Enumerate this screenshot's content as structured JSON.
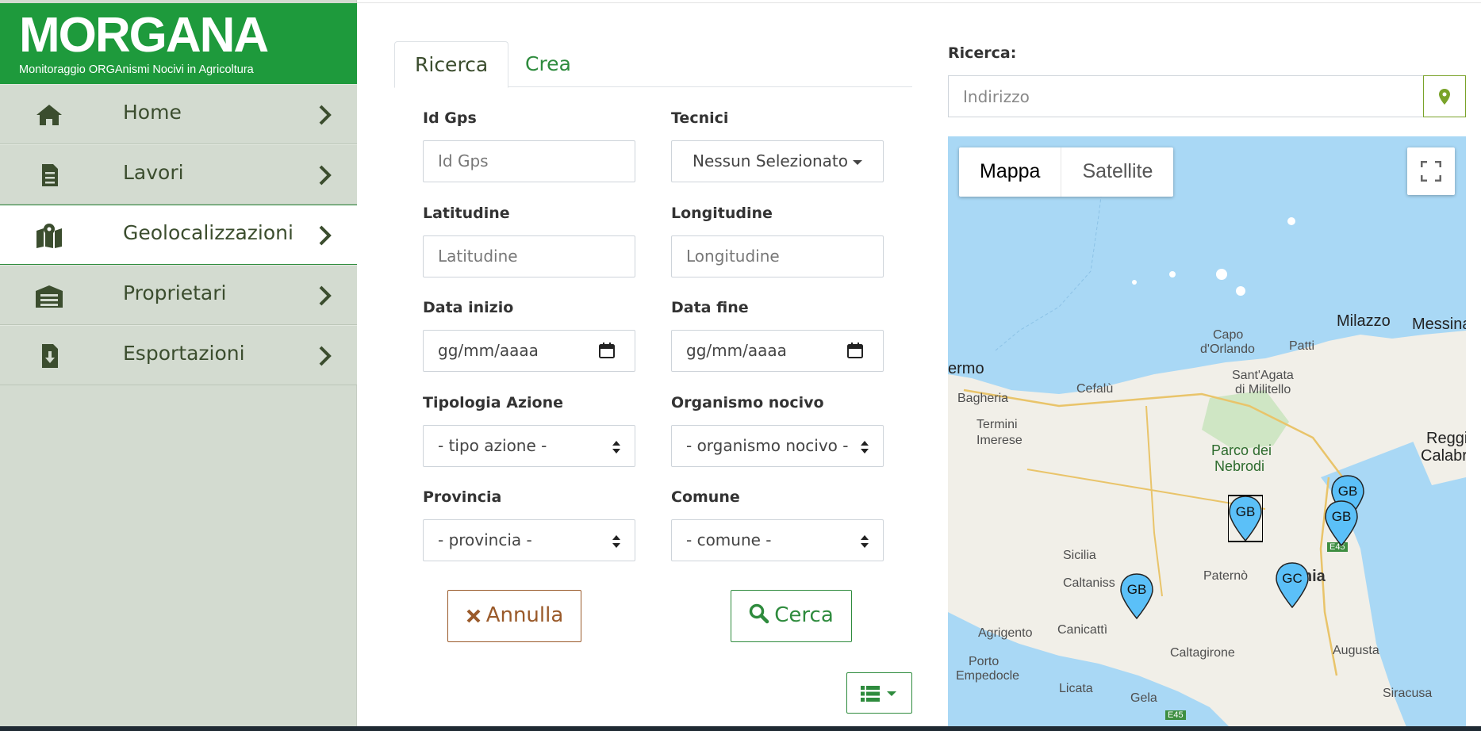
{
  "brand": {
    "title": "MORGANA",
    "subtitle": "Monitoraggio ORGAnismi Nocivi in Agricoltura",
    "color": "#1e9a3c"
  },
  "sidebar": {
    "items": [
      {
        "label": "Home",
        "icon": "home-icon",
        "active": false
      },
      {
        "label": "Lavori",
        "icon": "document-icon",
        "active": false
      },
      {
        "label": "Geolocalizzazioni",
        "icon": "map-marker-icon",
        "active": true
      },
      {
        "label": "Proprietari",
        "icon": "warehouse-icon",
        "active": false
      },
      {
        "label": "Esportazioni",
        "icon": "file-download-icon",
        "active": false
      }
    ]
  },
  "tabs": [
    {
      "label": "Ricerca",
      "active": true
    },
    {
      "label": "Crea",
      "active": false
    }
  ],
  "form": {
    "id_gps": {
      "label": "Id Gps",
      "placeholder": "Id Gps"
    },
    "tecnici": {
      "label": "Tecnici",
      "value": "Nessun Selezionato"
    },
    "latitudine": {
      "label": "Latitudine",
      "placeholder": "Latitudine"
    },
    "longitudine": {
      "label": "Longitudine",
      "placeholder": "Longitudine"
    },
    "data_inizio": {
      "label": "Data inizio",
      "placeholder": "gg/mm/aaaa"
    },
    "data_fine": {
      "label": "Data fine",
      "placeholder": "gg/mm/aaaa"
    },
    "tipologia_azione": {
      "label": "Tipologia Azione",
      "value": "- tipo azione -"
    },
    "organismo_nocivo": {
      "label": "Organismo nocivo",
      "value": "- organismo nocivo -"
    },
    "provincia": {
      "label": "Provincia",
      "value": "- provincia -"
    },
    "comune": {
      "label": "Comune",
      "value": "- comune -"
    },
    "annulla_label": "Annulla",
    "cerca_label": "Cerca"
  },
  "search": {
    "label": "Ricerca:",
    "placeholder": "Indirizzo"
  },
  "map": {
    "type_map": "Mappa",
    "type_satellite": "Satellite",
    "places": {
      "ermo": "ermo",
      "bagheria": "Bagheria",
      "termini": "Termini",
      "imerese": "Imerese",
      "cefalu": "Cefalù",
      "capo": "Capo",
      "dorlando": "d'Orlando",
      "patti": "Patti",
      "milazzo": "Milazzo",
      "messina": "Messina",
      "santagata": "Sant'Agata",
      "dimilitello": "di Militello",
      "parco": "Parco dei",
      "nebrodi": "Nebrodi",
      "reggi": "Reggi",
      "calabr": "Calabr",
      "sicilia": "Sicilia",
      "caltaniss": "Caltaniss",
      "paterno": "Paternò",
      "catania": "atania",
      "agrigento": "Agrigento",
      "canicatti": "Canicattì",
      "caltagirone": "Caltagirone",
      "augusta": "Augusta",
      "porto": "Porto",
      "empedocle": "Empedocle",
      "licata": "Licata",
      "gela": "Gela",
      "siracusa": "Siracusa",
      "e45a": "E45",
      "e45b": "E45"
    },
    "markers": [
      "GB",
      "GB",
      "GB",
      "GC",
      "GB"
    ]
  }
}
